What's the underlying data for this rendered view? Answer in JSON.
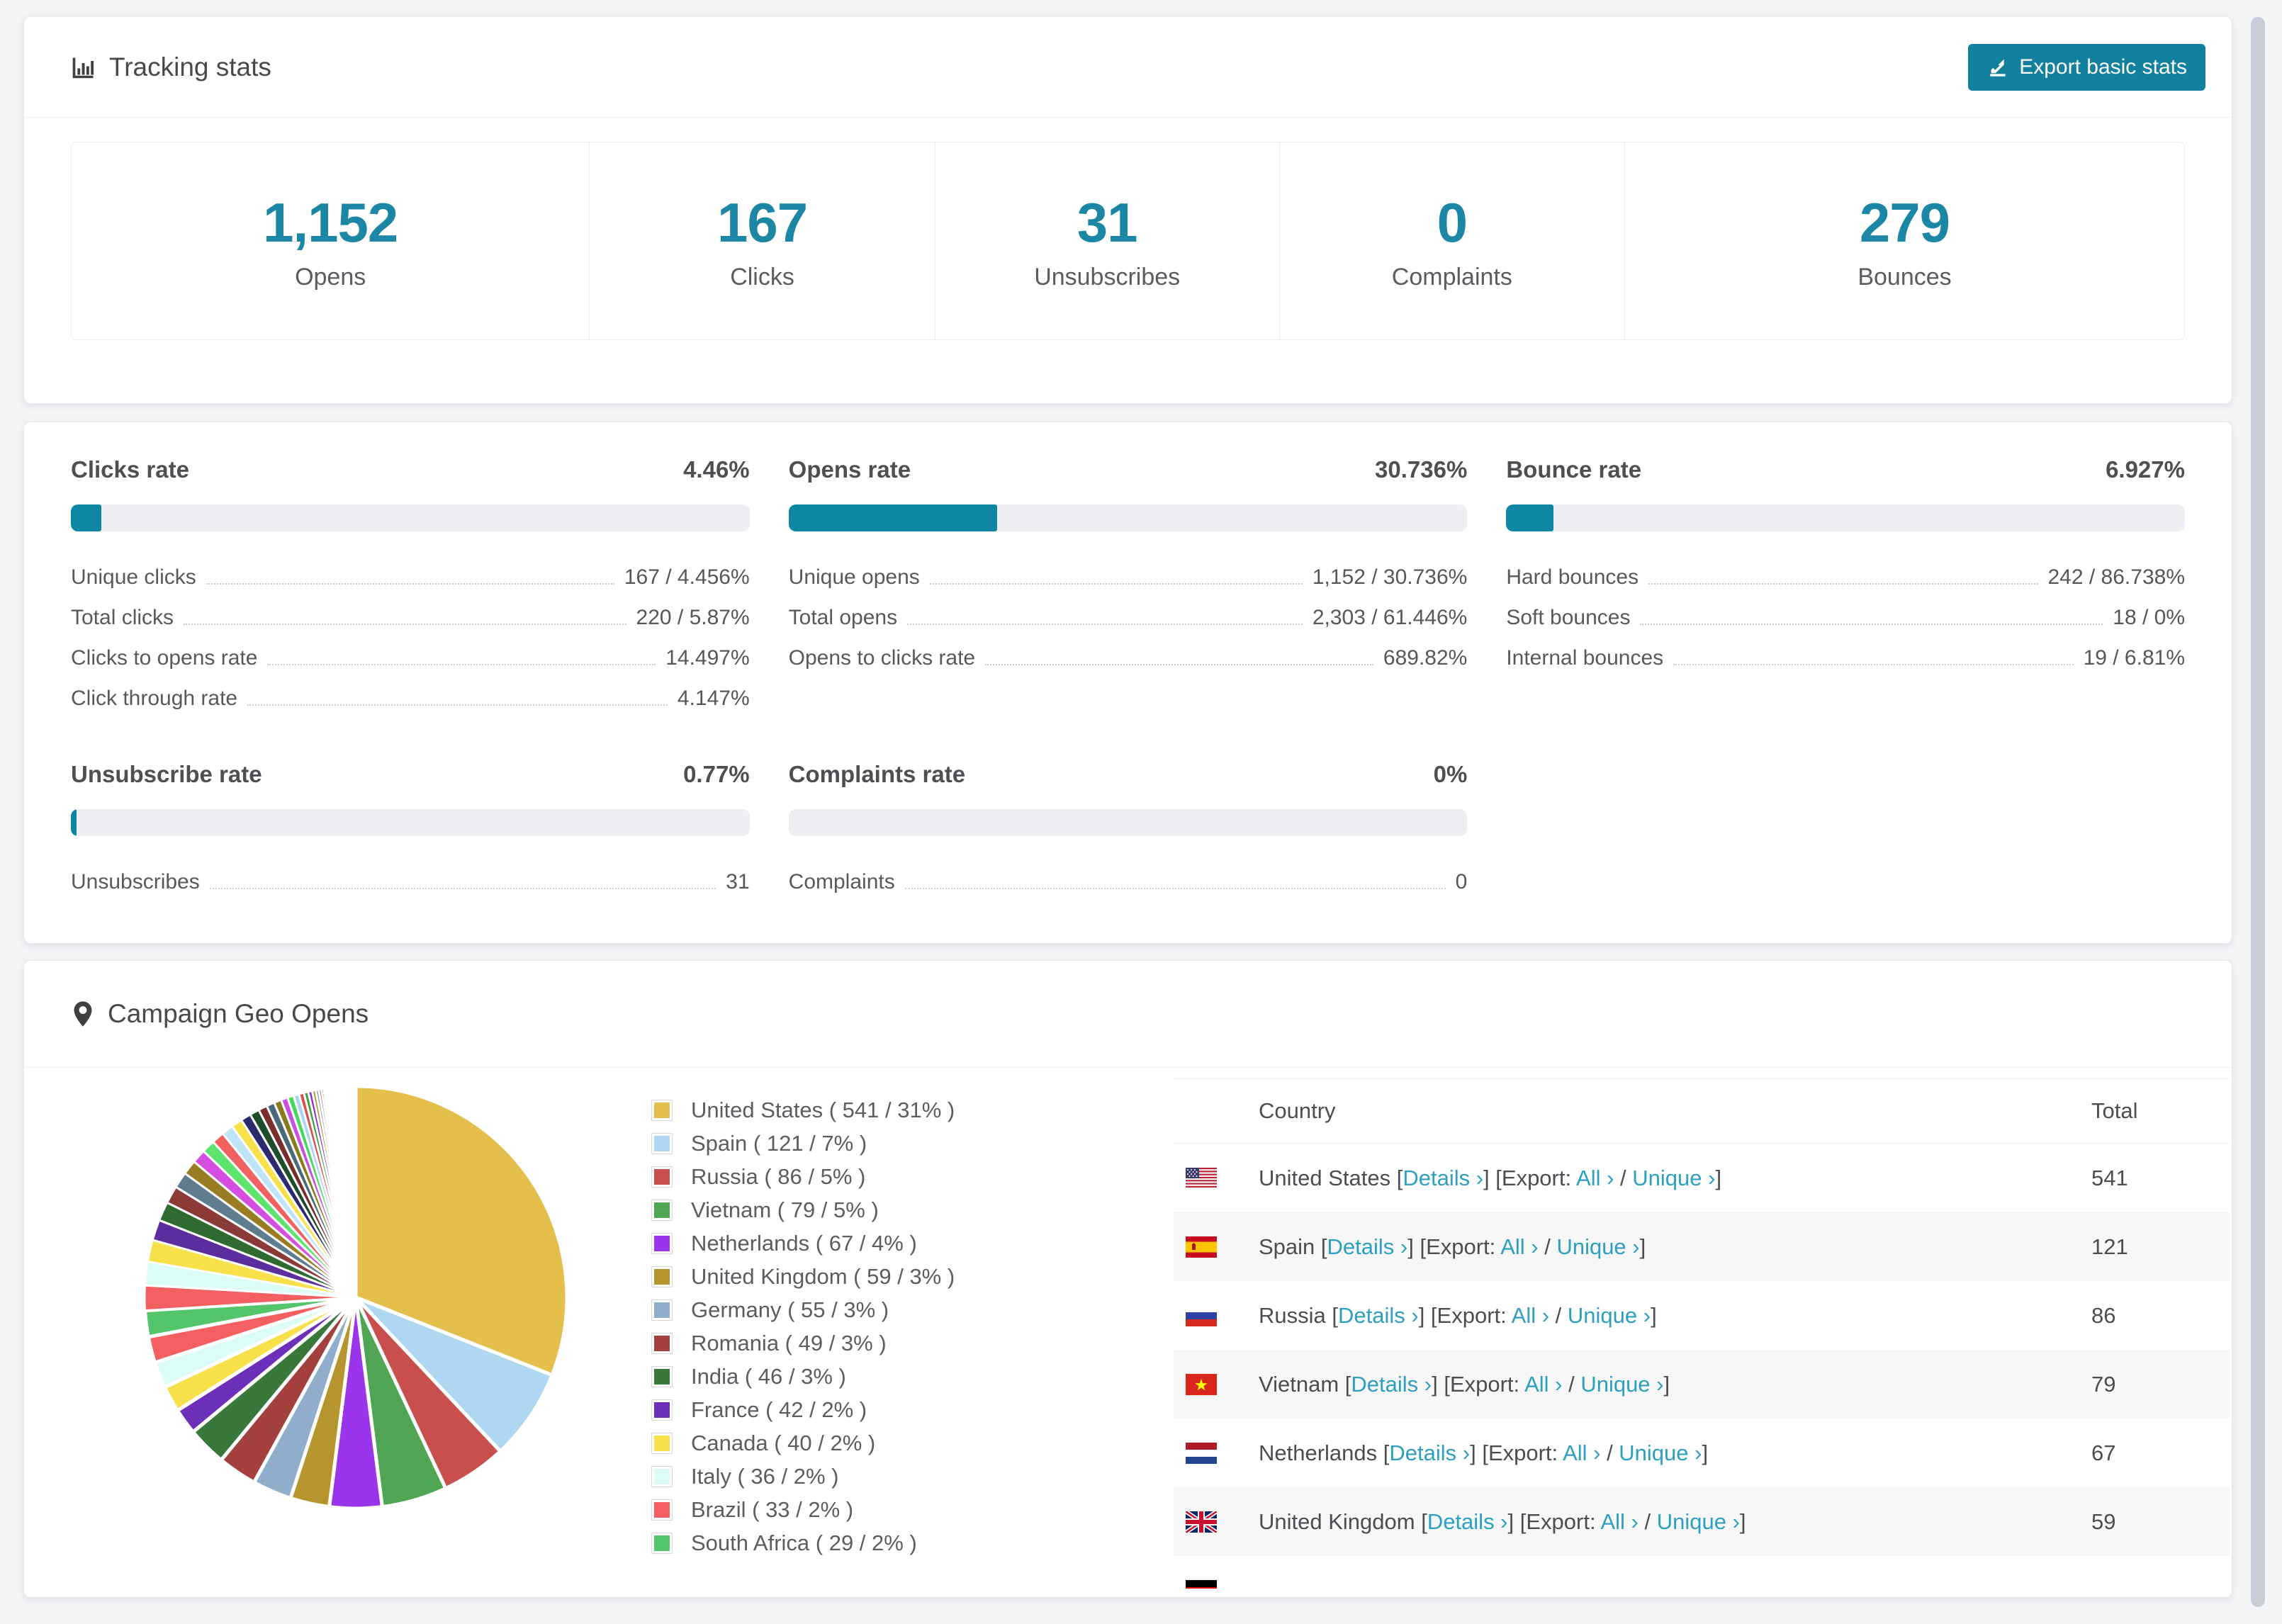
{
  "header": {
    "title": "Tracking stats",
    "export_button": "Export basic stats"
  },
  "summary": [
    {
      "value": "1,152",
      "label": "Opens"
    },
    {
      "value": "167",
      "label": "Clicks"
    },
    {
      "value": "31",
      "label": "Unsubscribes"
    },
    {
      "value": "0",
      "label": "Complaints"
    },
    {
      "value": "279",
      "label": "Bounces"
    }
  ],
  "rates": [
    {
      "key": "clicks",
      "title": "Clicks rate",
      "value": "4.46%",
      "percent": 4.46,
      "row": 1,
      "rows": [
        {
          "label": "Unique clicks",
          "value": "167 / 4.456%"
        },
        {
          "label": "Total clicks",
          "value": "220 / 5.87%"
        },
        {
          "label": "Clicks to opens rate",
          "value": "14.497%"
        },
        {
          "label": "Click through rate",
          "value": "4.147%"
        }
      ]
    },
    {
      "key": "opens",
      "title": "Opens rate",
      "value": "30.736%",
      "percent": 30.736,
      "row": 1,
      "rows": [
        {
          "label": "Unique opens",
          "value": "1,152 / 30.736%"
        },
        {
          "label": "Total opens",
          "value": "2,303 / 61.446%"
        },
        {
          "label": "Opens to clicks rate",
          "value": "689.82%"
        }
      ]
    },
    {
      "key": "bounce",
      "title": "Bounce rate",
      "value": "6.927%",
      "percent": 6.927,
      "row": 1,
      "rows": [
        {
          "label": "Hard bounces",
          "value": "242 / 86.738%"
        },
        {
          "label": "Soft bounces",
          "value": "18 / 0%"
        },
        {
          "label": "Internal bounces",
          "value": "19 / 6.81%"
        }
      ]
    },
    {
      "key": "unsubscribe",
      "title": "Unsubscribe rate",
      "value": "0.77%",
      "percent": 0.77,
      "row": 2,
      "rows": [
        {
          "label": "Unsubscribes",
          "value": "31"
        }
      ]
    },
    {
      "key": "complaints",
      "title": "Complaints rate",
      "value": "0%",
      "percent": 0,
      "row": 2,
      "rows": [
        {
          "label": "Complaints",
          "value": "0"
        }
      ]
    }
  ],
  "geo": {
    "title": "Campaign Geo Opens",
    "columns": {
      "country": "Country",
      "total": "Total"
    },
    "link_labels": {
      "details": "Details ›",
      "export": "Export:",
      "all": "All ›",
      "unique": "Unique ›"
    },
    "rows": [
      {
        "flag": "us",
        "country": "United States",
        "total": "541"
      },
      {
        "flag": "es",
        "country": "Spain",
        "total": "121"
      },
      {
        "flag": "ru",
        "country": "Russia",
        "total": "86"
      },
      {
        "flag": "vn",
        "country": "Vietnam",
        "total": "79"
      },
      {
        "flag": "nl",
        "country": "Netherlands",
        "total": "67"
      },
      {
        "flag": "gb",
        "country": "United Kingdom",
        "total": "59"
      }
    ],
    "partial_row": {
      "flag": "de"
    }
  },
  "chart_data": {
    "type": "pie",
    "title": "Campaign Geo Opens",
    "unit": "opens",
    "legend_position": "right",
    "slices": [
      {
        "label": "United States",
        "value": 541,
        "pct": 31,
        "color": "#E5BF4B"
      },
      {
        "label": "Spain",
        "value": 121,
        "pct": 7,
        "color": "#AFD7F2"
      },
      {
        "label": "Russia",
        "value": 86,
        "pct": 5,
        "color": "#C94F4F"
      },
      {
        "label": "Vietnam",
        "value": 79,
        "pct": 5,
        "color": "#4FA553"
      },
      {
        "label": "Netherlands",
        "value": 67,
        "pct": 4,
        "color": "#9A35EC"
      },
      {
        "label": "United Kingdom",
        "value": 59,
        "pct": 3,
        "color": "#B6952F"
      },
      {
        "label": "Germany",
        "value": 55,
        "pct": 3,
        "color": "#90AECB"
      },
      {
        "label": "Romania",
        "value": 49,
        "pct": 3,
        "color": "#A33F3C"
      },
      {
        "label": "India",
        "value": 46,
        "pct": 3,
        "color": "#38793B"
      },
      {
        "label": "France",
        "value": 42,
        "pct": 2,
        "color": "#6B2FB9"
      },
      {
        "label": "Canada",
        "value": 40,
        "pct": 2,
        "color": "#F8E04B"
      },
      {
        "label": "Italy",
        "value": 36,
        "pct": 2,
        "color": "#DCFCF7"
      },
      {
        "label": "Brazil",
        "value": 33,
        "pct": 2,
        "color": "#F46061"
      },
      {
        "label": "South Africa",
        "value": 29,
        "pct": 2,
        "color": "#54C56B"
      }
    ],
    "others": {
      "label": "unlabeled small countries",
      "total_pct_approx": 24.5,
      "weights": [
        1.7,
        1.6,
        1.5,
        1.4,
        1.3,
        1.2,
        1.1,
        1.0,
        0.95,
        0.9,
        0.85,
        0.8,
        0.75,
        0.7,
        0.65,
        0.6,
        0.55,
        0.5,
        0.46,
        0.42,
        0.38,
        0.34,
        0.3,
        0.27,
        0.24,
        0.21,
        0.18,
        0.16,
        0.14,
        0.12,
        0.1,
        0.09,
        0.08,
        0.07,
        0.06,
        0.05,
        0.04,
        0.03,
        0.03,
        0.02
      ],
      "palette": [
        "#F46061",
        "#DCFCF7",
        "#F8E04B",
        "#5B2D9E",
        "#2F6B31",
        "#8C3A38",
        "#5F7D8F",
        "#9A7D22",
        "#D44FE0",
        "#5EE36E",
        "#F26161",
        "#BFE3F7",
        "#F7E14B",
        "#2B2A6E",
        "#1D4D2A",
        "#7A2E2C",
        "#4A6A77",
        "#8A7A1E",
        "#C94FE0",
        "#44D95C",
        "#A9D3F0",
        "#D94F4F",
        "#3FA045",
        "#8A2BE2",
        "#B08C2A",
        "#7F9FBA",
        "#993C3C",
        "#2E5E30",
        "#6632B8",
        "#EFE04A",
        "#C9F5EE",
        "#EF5F5F",
        "#49BF66",
        "#9C4FD9",
        "#E3C44C",
        "#A3CFF0",
        "#D25454",
        "#47A24B",
        "#7E3BD0",
        "#C2A030"
      ]
    }
  },
  "colors": {
    "accent": "#13809d",
    "stat_number": "#1b87a4",
    "bar_fill": "#0e86a4",
    "link": "#2d9fc0"
  }
}
